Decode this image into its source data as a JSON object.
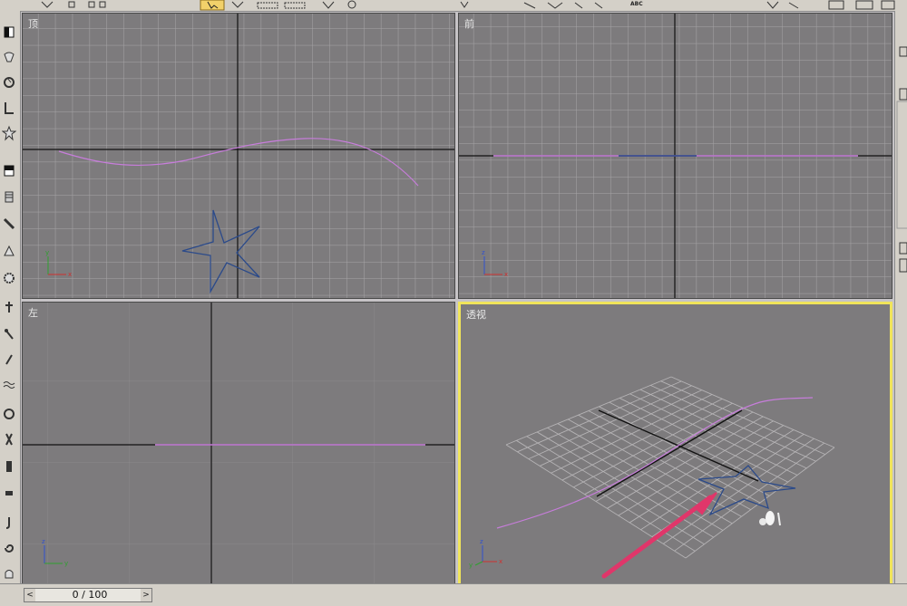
{
  "viewports": {
    "top": {
      "label": "顶"
    },
    "front": {
      "label": "前"
    },
    "left": {
      "label": "左"
    },
    "perspective": {
      "label": "透视"
    }
  },
  "axis_labels": {
    "x": "x",
    "y": "y",
    "z": "z"
  },
  "timeline": {
    "value": "0 / 100",
    "prev": "<",
    "next": ">"
  },
  "toolbar": {
    "text_tool": "ABC"
  },
  "colors": {
    "viewport_bg": "#7d7b7d",
    "grid": "#a7a5a7",
    "active_border": "#f0e45a",
    "spline": "#c77ddb",
    "star": "#2b4a8a",
    "arrow": "#e0366a"
  },
  "icons": [
    "select-icon",
    "move-icon",
    "rotate-icon",
    "scale-icon",
    "text-icon",
    "star-shape-icon",
    "box-icon",
    "cylinder-icon",
    "bend-icon",
    "gear-icon",
    "wave-icon"
  ]
}
